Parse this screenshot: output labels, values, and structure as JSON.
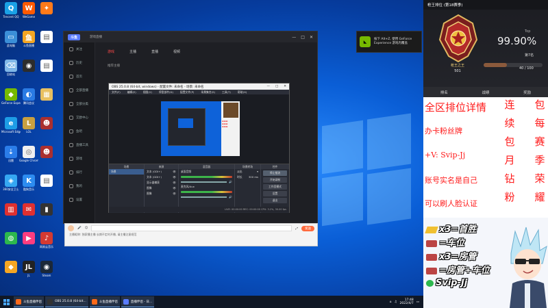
{
  "desktop": {
    "icons": [
      {
        "label": "Tencent QQ",
        "color": "#1aa1e6",
        "glyph": "Q"
      },
      {
        "label": "WeGame",
        "color": "#ff5a00",
        "glyph": "W"
      },
      {
        "label": "",
        "color": "#ff7a1a",
        "glyph": "✦"
      },
      {
        "label": "此电脑",
        "color": "#3b8fd8",
        "glyph": "▭"
      },
      {
        "label": "斗鱼直播",
        "color": "#f5a623",
        "glyph": "鱼"
      },
      {
        "label": "",
        "color": "#ffffff",
        "glyph": "▤"
      },
      {
        "label": "回收站",
        "color": "#7fb7e8",
        "glyph": "⌫"
      },
      {
        "label": "",
        "color": "#2c2c2c",
        "glyph": "◉"
      },
      {
        "label": "",
        "color": "#ffffff",
        "glyph": "▤"
      },
      {
        "label": "GeForce Experience",
        "color": "#76b900",
        "glyph": "◆"
      },
      {
        "label": "腾讯会议",
        "color": "#2a7be4",
        "glyph": "◐"
      },
      {
        "label": "",
        "color": "#e8c060",
        "glyph": "▦"
      },
      {
        "label": "Microsoft Edge",
        "color": "#1e9de6",
        "glyph": "e"
      },
      {
        "label": "LOL",
        "color": "#c8a040",
        "glyph": "L"
      },
      {
        "label": "",
        "color": "#aa3030",
        "glyph": "☻"
      },
      {
        "label": "迅雷",
        "color": "#2b7de9",
        "glyph": "⇣"
      },
      {
        "label": "Google Chrome",
        "color": "#f0f0f0",
        "glyph": "◎"
      },
      {
        "label": "",
        "color": "#aa3030",
        "glyph": "☻"
      },
      {
        "label": "360安全卫士",
        "color": "#35a7f2",
        "glyph": "◈"
      },
      {
        "label": "酷狗音乐",
        "color": "#2d8cf0",
        "glyph": "K"
      },
      {
        "label": "",
        "color": "#ffffff",
        "glyph": "▤"
      },
      {
        "label": "",
        "color": "#e03030",
        "glyph": "▥"
      },
      {
        "label": "",
        "color": "#e03030",
        "glyph": "✉"
      },
      {
        "label": "",
        "color": "#333333",
        "glyph": "▮"
      },
      {
        "label": "",
        "color": "#2db84d",
        "glyph": "◍"
      },
      {
        "label": "",
        "color": "#ff3d7f",
        "glyph": "▶"
      },
      {
        "label": "网易云音乐",
        "color": "#d33a31",
        "glyph": "♪"
      },
      {
        "label": "",
        "color": "#f5a623",
        "glyph": "◆"
      },
      {
        "label": "JL",
        "color": "#222222",
        "glyph": "JL"
      },
      {
        "label": "Steam",
        "color": "#1b2838",
        "glyph": "◉"
      }
    ]
  },
  "taskbar": {
    "items": [
      {
        "label": "斗鱼直播伴侣",
        "color": "#ff6a1a"
      },
      {
        "label": "OBS 25.0.8 (64-bit...",
        "color": "#333333"
      },
      {
        "label": "斗鱼直播伴侣",
        "color": "#ff6a1a"
      },
      {
        "label": "直播伴侣 - 日...",
        "color": "#5a7cff"
      }
    ],
    "time": "17:48",
    "date": "2022/4/7"
  },
  "livewin": {
    "logo": "斗鱼",
    "title_tag": "游戏直播",
    "tabs": [
      "游戏",
      "主播",
      "直播",
      "视频"
    ],
    "sidebar": [
      "关注",
      "历史",
      "首页",
      "全部直播",
      "全部分类",
      "艾欧中心",
      "鱼吧",
      "直播工具",
      "游戏",
      "排行",
      "我的",
      "设置"
    ],
    "section_title": "推荐主播"
  },
  "obs": {
    "title": "OBS 25.0.8 (64-bit, windows) - 配置文件: 未命名 - 场景: 未命名",
    "menu": [
      "文件(F)",
      "编辑(E)",
      "视图(V)",
      "停靠部件(D)",
      "配置文件(P)",
      "场景集合(S)",
      "工具(T)",
      "帮助(H)"
    ],
    "docks": {
      "scenes": "场景",
      "sources": "来源",
      "mixer": "混音器",
      "transitions": "场景转场",
      "controls": "控件"
    },
    "scene_item": "场景",
    "source_items": [
      "文本 (GDI+)",
      "文本 (GDI+)",
      "显示器捕获",
      "图像",
      "图像"
    ],
    "mixer_items": [
      "桌面音频",
      "麦克风/Aux"
    ],
    "transition": "淡出",
    "duration_label": "时长",
    "duration": "300 ms",
    "controls": [
      "停止推流",
      "开始录制",
      "工作室模式",
      "设置",
      "退出"
    ],
    "status": "LIVE: 00:00:00  REC: 00:00:00  CPU: 3.2%, 30.00 fps"
  },
  "chatbar": {
    "placeholder": "",
    "send": "发送",
    "notice": "主播昵称: 独家播主播 长期不定时开播, 请主播注意规范"
  },
  "nvpopup": {
    "line1": "按下 Alt+Z, 使用 GeForce",
    "line2": "Experience 游戏内覆盖"
  },
  "overlay": {
    "rank_title": "枪王排位 (第18赛季)",
    "rank_name": "枪王之王",
    "rank_score": "501",
    "top_label": "Top",
    "top_pct": "99.90%",
    "place": "第7名",
    "progress_text": "40 / 100",
    "progress_fraction": 0.4,
    "tabs": [
      "排名",
      "战绩",
      "奖励"
    ],
    "text_main": [
      "全区排位详情",
      "办卡粉丝牌",
      "+V: Svip-Jj",
      "账号实名是自己",
      "可以刷人脸认证"
    ],
    "col1": [
      "连",
      "续",
      "包",
      "月",
      "钻",
      "粉"
    ],
    "col2": [
      "包",
      "每",
      "赛",
      "季",
      "荣",
      "耀"
    ],
    "bottom_lines": [
      "x3=首胜",
      "=车位",
      "x3=房管",
      "=房管+车位",
      "Svip-Jj"
    ]
  }
}
